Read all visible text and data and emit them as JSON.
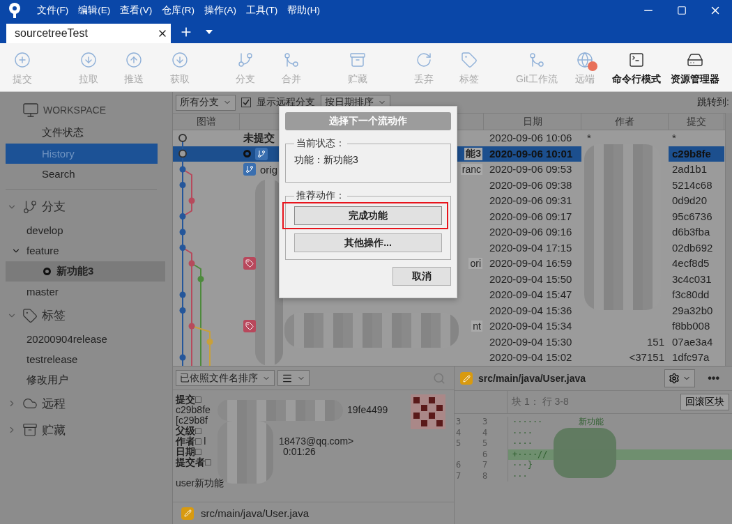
{
  "menu": [
    "文件(F)",
    "编辑(E)",
    "查看(V)",
    "仓库(R)",
    "操作(A)",
    "工具(T)",
    "帮助(H)"
  ],
  "tabs": [
    {
      "label": "sourcetreeTest",
      "selected": true
    }
  ],
  "toolbar": [
    {
      "label": "提交",
      "disabled": true
    },
    {
      "label": "拉取",
      "disabled": true
    },
    {
      "label": "推送",
      "disabled": true
    },
    {
      "label": "获取",
      "disabled": true
    },
    {
      "label": "分支",
      "disabled": true
    },
    {
      "label": "合并",
      "disabled": true
    },
    {
      "label": "贮藏",
      "disabled": true
    },
    {
      "label": "丢弃",
      "disabled": true
    },
    {
      "label": "标签",
      "disabled": true
    },
    {
      "label": "Git工作流",
      "disabled": true
    },
    {
      "label": "远端",
      "disabled": true,
      "alert": true
    },
    {
      "label": "命令行模式",
      "disabled": false
    },
    {
      "label": "资源管理器",
      "disabled": false
    }
  ],
  "sidebar": {
    "workspace": {
      "title": "WORKSPACE",
      "items": [
        {
          "label": "文件状态",
          "selected": false
        },
        {
          "label": "History",
          "selected": true
        },
        {
          "label": "Search",
          "selected": false
        }
      ]
    },
    "sections": [
      {
        "title": "分支",
        "expanded": true,
        "items": [
          {
            "label": "develop",
            "current": false
          },
          {
            "label": "feature",
            "current": false,
            "expanded": true,
            "children": [
              {
                "label": "新功能3",
                "current": true
              }
            ]
          },
          {
            "label": "master",
            "current": false
          }
        ]
      },
      {
        "title": "标签",
        "expanded": true,
        "items": [
          {
            "label": "20200904release",
            "current": false
          },
          {
            "label": "testrelease",
            "current": false
          },
          {
            "label": "修改用户",
            "current": false
          }
        ]
      },
      {
        "title": "远程",
        "expanded": false
      },
      {
        "title": "贮藏",
        "expanded": false
      }
    ]
  },
  "history": {
    "branch_filter": "所有分支",
    "show_remote": {
      "label": "显示远程分支",
      "checked": true
    },
    "sort": "按日期排序",
    "jump_label": "跳转到:",
    "columns": [
      "图谱",
      "日期",
      "作者",
      "提交"
    ],
    "rows": [
      {
        "kind": "plain",
        "description": "未提交",
        "date": "2020-09-06 10:06",
        "author": "*",
        "commit": "*",
        "selected": false
      },
      {
        "kind": "head",
        "tail": "能3",
        "date": "2020-09-06 10:01",
        "commit": "c29b8fe",
        "selected": true
      },
      {
        "kind": "branch",
        "description": "orig",
        "tail": "ranc",
        "date": "2020-09-06 09:53",
        "commit": "2ad1b1",
        "selected": false
      },
      {
        "kind": "plain",
        "date": "2020-09-06 09:38",
        "commit": "5214c68",
        "selected": false
      },
      {
        "kind": "plain",
        "date": "2020-09-06 09:31",
        "commit": "0d9d20",
        "selected": false
      },
      {
        "kind": "plain",
        "date": "2020-09-06 09:17",
        "commit": "95c6736",
        "selected": false
      },
      {
        "kind": "plain",
        "date": "2020-09-06 09:16",
        "commit": "d6b3fba",
        "selected": false
      },
      {
        "kind": "plain",
        "date": "2020-09-04 17:15",
        "commit": "02db692",
        "selected": false
      },
      {
        "kind": "tag",
        "tail": "ori",
        "date": "2020-09-04 16:59",
        "commit": "4ecf8d5",
        "selected": false
      },
      {
        "kind": "plain",
        "date": "2020-09-04 15:50",
        "commit": "3c4c031",
        "selected": false
      },
      {
        "kind": "plain",
        "date": "2020-09-04 15:47",
        "commit": "f3c80dd",
        "selected": false
      },
      {
        "kind": "plain",
        "date": "2020-09-04 15:36",
        "commit": "29a32b0",
        "selected": false
      },
      {
        "kind": "tag",
        "tail": "nt",
        "date": "2020-09-04 15:34",
        "commit": "f8bb008",
        "selected": false
      },
      {
        "kind": "plain",
        "date": "2020-09-04 15:30",
        "author": "151",
        "commit": "07ae3a4",
        "selected": false
      },
      {
        "kind": "plain",
        "date": "2020-09-04 15:02",
        "author": "<37151",
        "commit": "1dfc97a",
        "selected": false
      }
    ]
  },
  "details": {
    "sort": "已依照文件名排序",
    "lines": [
      {
        "label": "提交□"
      },
      {
        "value": "c29b8fe",
        "tail": "19fe4499"
      },
      {
        "value": "[c29b8f"
      },
      {
        "label": "父级□"
      },
      {
        "label": "作者□",
        "value": " l",
        "tail": "18473@qq.com>"
      },
      {
        "label": "日期□",
        "tail": "0:01:26"
      },
      {
        "label": "提交者□"
      }
    ],
    "message": "user新功能",
    "files": [
      "src/main/java/User.java"
    ]
  },
  "diff": {
    "file": "src/main/java/User.java",
    "more": "•••",
    "hunk": "块 1： 行 3-8",
    "revert": "回滚区块",
    "lines": [
      {
        "old": "3",
        "new": "3",
        "text": "······",
        "tail": "新功能",
        "added": false
      },
      {
        "old": "4",
        "new": "4",
        "text": "····",
        "added": false
      },
      {
        "old": "5",
        "new": "5",
        "text": "····",
        "added": false
      },
      {
        "new": "6",
        "text": "+····//",
        "added": true
      },
      {
        "old": "6",
        "new": "7",
        "text": "···}",
        "added": false
      },
      {
        "old": "7",
        "new": "8",
        "text": "···",
        "added": false
      }
    ]
  },
  "dialog": {
    "title": "选择下一个流动作",
    "state_label": "当前状态：",
    "state": "功能：新功能3",
    "actions_label": "推荐动作：",
    "actions": [
      {
        "label": "完成功能",
        "highlighted": true
      },
      {
        "label": "其他操作...",
        "highlighted": false
      }
    ],
    "cancel": "取消"
  }
}
